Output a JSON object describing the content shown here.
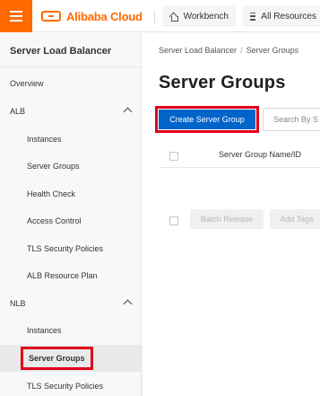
{
  "topbar": {
    "logo_text": "Alibaba Cloud",
    "workbench_label": "Workbench",
    "all_resources_label": "All Resources",
    "brand_color": "#ff6a00"
  },
  "sidebar": {
    "title": "Server Load Balancer",
    "items": [
      {
        "label": "Overview"
      },
      {
        "label": "ALB"
      },
      {
        "label": "Instances"
      },
      {
        "label": "Server Groups"
      },
      {
        "label": "Health Check"
      },
      {
        "label": "Access Control"
      },
      {
        "label": "TLS Security Policies"
      },
      {
        "label": "ALB Resource Plan"
      },
      {
        "label": "NLB"
      },
      {
        "label": "Instances"
      },
      {
        "label": "Server Groups"
      },
      {
        "label": "TLS Security Policies"
      }
    ]
  },
  "main": {
    "breadcrumb": [
      "Server Load Balancer",
      "Server Groups"
    ],
    "breadcrumb_separator": "/",
    "title": "Server Groups",
    "create_button": "Create Server Group",
    "search_placeholder": "Search By S",
    "columns": [
      "Server Group Name/ID"
    ],
    "batch_release": "Batch Release",
    "add_tags": "Add Tags",
    "primary_color": "#0064c8",
    "highlight_color": "#e00018"
  }
}
